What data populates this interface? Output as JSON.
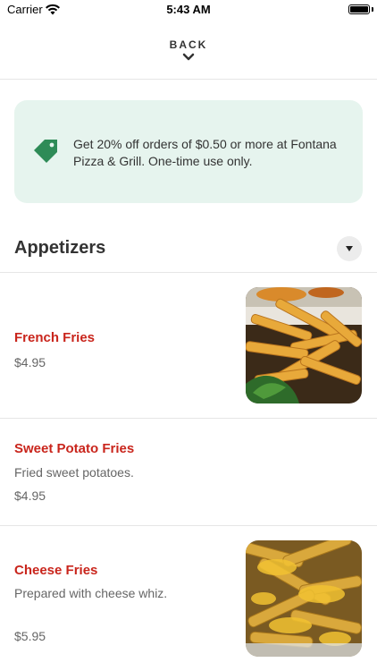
{
  "status_bar": {
    "carrier": "Carrier",
    "time": "5:43 AM"
  },
  "header": {
    "back_label": "BACK"
  },
  "promo": {
    "text": "Get 20% off orders of $0.50 or more at Fontana Pizza & Grill. One-time use only.",
    "accent_color": "#2e8b57",
    "background": "#e6f4ee"
  },
  "section": {
    "title": "Appetizers"
  },
  "items": [
    {
      "name": "French Fries",
      "description": "",
      "price": "$4.95",
      "photo": "french-fries"
    },
    {
      "name": "Sweet Potato Fries",
      "description": "Fried sweet potatoes.",
      "price": "$4.95",
      "photo": ""
    },
    {
      "name": "Cheese Fries",
      "description": "Prepared with cheese whiz.",
      "price": "$5.95",
      "photo": "cheese-fries"
    }
  ],
  "colors": {
    "item_name": "#c9251c",
    "muted_text": "#666666",
    "divider": "#e6e6e6"
  }
}
